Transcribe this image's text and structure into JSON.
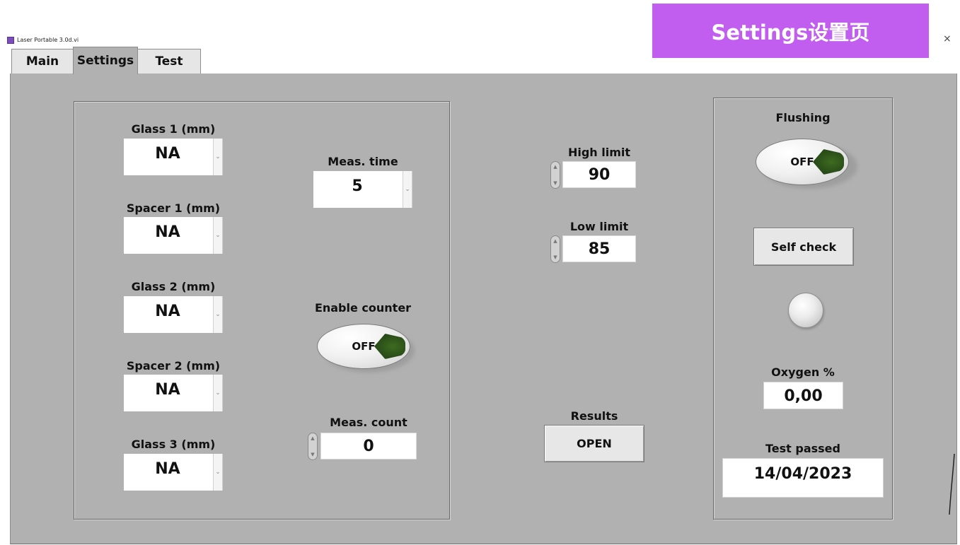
{
  "window": {
    "title": "Laser Portable 3.0d.vi",
    "close_glyph": "×"
  },
  "banner": {
    "text": "Settings设置页",
    "color": "#c15ef0"
  },
  "tabs": [
    {
      "label": "Main"
    },
    {
      "label": "Settings",
      "selected": true
    },
    {
      "label": "Test"
    }
  ],
  "thickness": {
    "glass1": {
      "label": "Glass 1 (mm)",
      "value": "NA"
    },
    "spacer1": {
      "label": "Spacer 1 (mm)",
      "value": "NA"
    },
    "glass2": {
      "label": "Glass 2 (mm)",
      "value": "NA"
    },
    "spacer2": {
      "label": "Spacer 2 (mm)",
      "value": "NA"
    },
    "glass3": {
      "label": "Glass 3 (mm)",
      "value": "NA"
    }
  },
  "measurement": {
    "time_label": "Meas. time",
    "time_value": "5",
    "counter_label": "Enable counter",
    "counter_state": "OFF",
    "count_label": "Meas. count",
    "count_value": "0"
  },
  "limits": {
    "high_label": "High limit",
    "high_value": "90",
    "low_label": "Low limit",
    "low_value": "85"
  },
  "results": {
    "label": "Results",
    "button": "OPEN"
  },
  "right_panel": {
    "flushing_label": "Flushing",
    "flushing_state": "OFF",
    "self_check_button": "Self check",
    "oxygen_label": "Oxygen %",
    "oxygen_value": "0,00",
    "test_passed_label": "Test passed",
    "test_passed_value": "14/04/2023"
  },
  "icons": {
    "dropdown": "chevron-down-icon",
    "spinner": "up-down-spinner-icon",
    "led": "led-indicator-icon",
    "app": "labview-vi-icon"
  },
  "colors": {
    "panel_bg": "#b1b1b1",
    "led_on_green": "#2a4d18"
  }
}
